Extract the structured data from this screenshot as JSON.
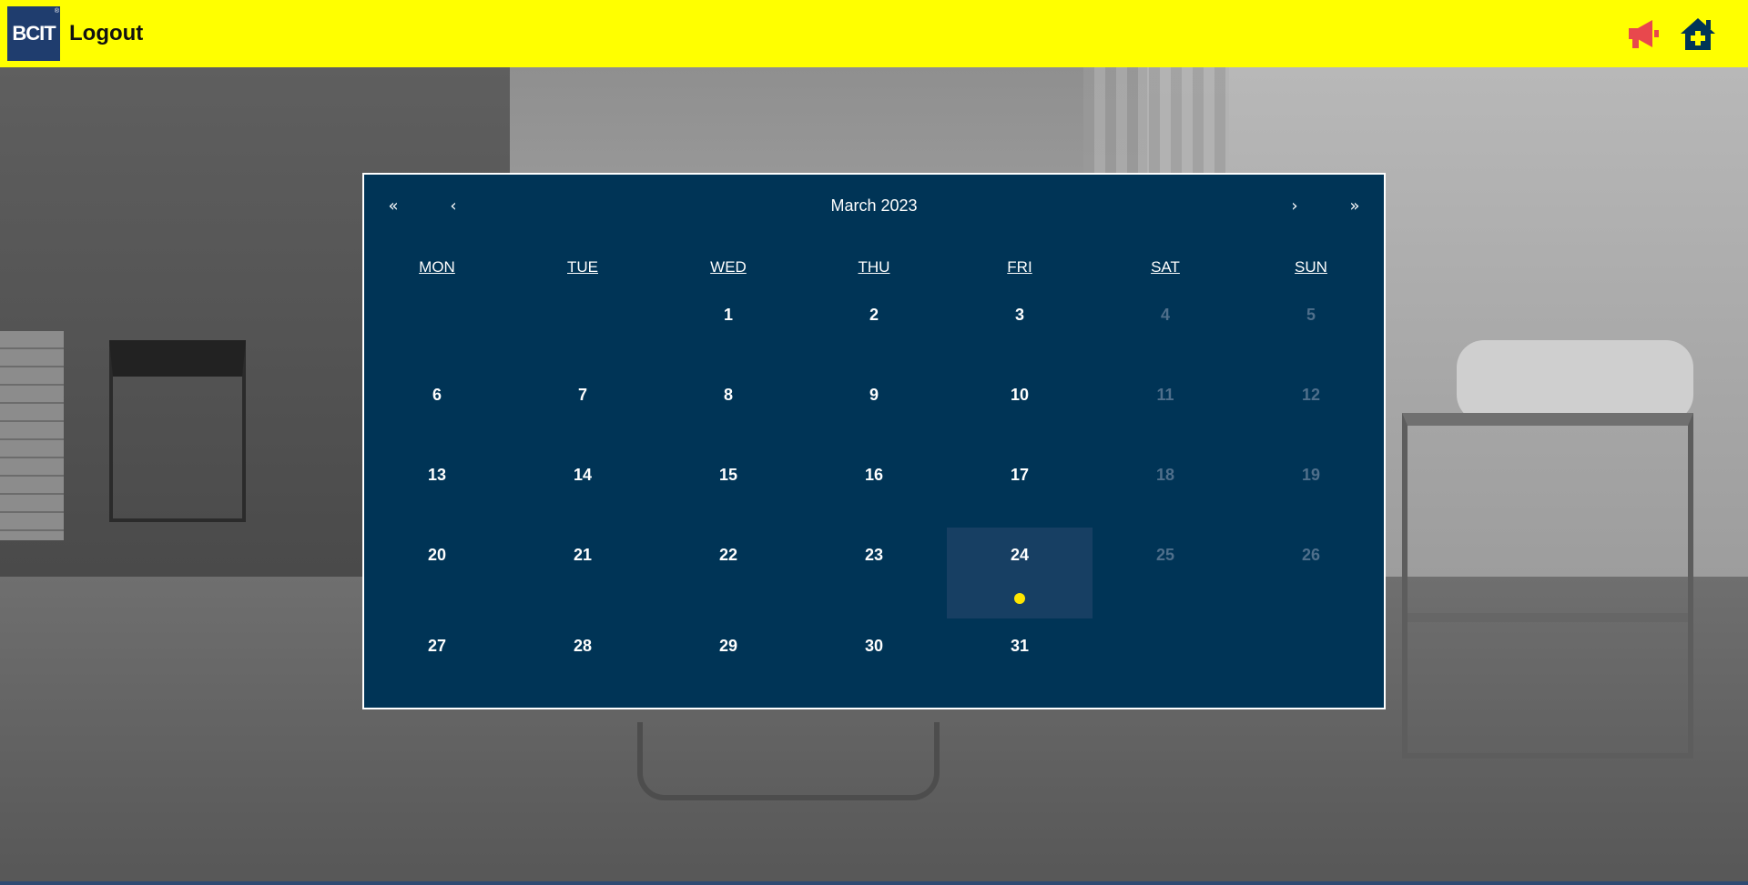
{
  "header": {
    "logo_text": "BCIT",
    "logo_mark": "®",
    "logout_label": "Logout",
    "icons": [
      "megaphone-icon",
      "house-plus-icon"
    ],
    "background_color": "#ffff00",
    "megaphone_color": "#e8484d",
    "house_color": "#003456"
  },
  "calendar": {
    "nav": {
      "prev_year": "«",
      "prev_month": "‹",
      "title": "March 2023",
      "next_month": "›",
      "next_year": "»"
    },
    "weekdays": [
      "MON",
      "TUE",
      "WED",
      "THU",
      "FRI",
      "SAT",
      "SUN"
    ],
    "weeks": [
      [
        "",
        "",
        "1",
        "2",
        "3",
        "4",
        "5"
      ],
      [
        "6",
        "7",
        "8",
        "9",
        "10",
        "11",
        "12"
      ],
      [
        "13",
        "14",
        "15",
        "16",
        "17",
        "18",
        "19"
      ],
      [
        "20",
        "21",
        "22",
        "23",
        "24",
        "25",
        "26"
      ],
      [
        "27",
        "28",
        "29",
        "30",
        "31",
        "",
        ""
      ]
    ],
    "active_day": "24",
    "event_days": [
      "24"
    ],
    "colors": {
      "background": "#003456",
      "active_day": "#173f63",
      "weekend_text": "#4f6f8b",
      "event_dot": "#ffe600"
    }
  }
}
